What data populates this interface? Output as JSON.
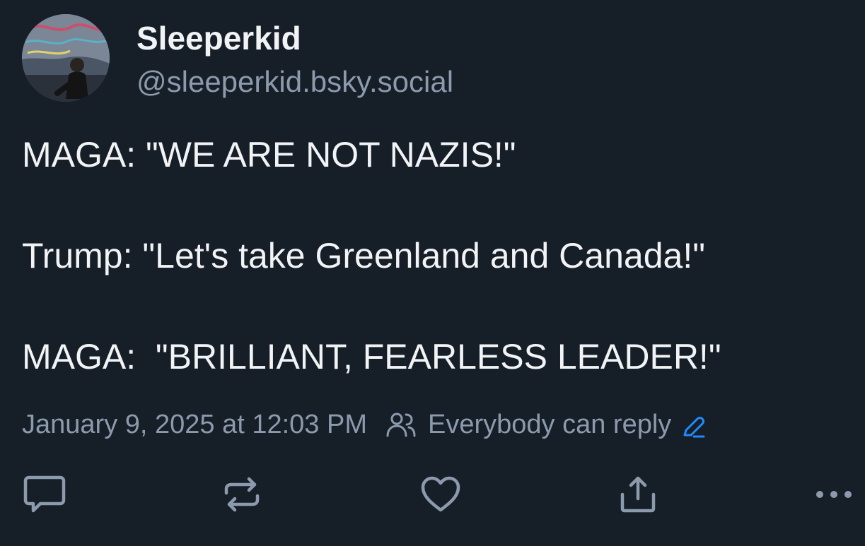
{
  "post": {
    "author": {
      "display_name": "Sleeperkid",
      "handle": "@sleeperkid.bsky.social",
      "avatar_icon": "avatar-photo"
    },
    "lines": [
      "MAGA: \"WE ARE NOT NAZIS!\"",
      "Trump: \"Let's take Greenland and Canada!\"",
      "MAGA:  \"BRILLIANT, FEARLESS LEADER!\""
    ],
    "meta": {
      "timestamp": "January 9, 2025 at 12:03 PM",
      "reply_setting": "Everybody can reply",
      "reply_setting_icon": "people-icon",
      "edit_icon": "pencil-icon"
    },
    "actions": [
      {
        "name": "reply",
        "icon": "comment-icon"
      },
      {
        "name": "repost",
        "icon": "repost-icon"
      },
      {
        "name": "like",
        "icon": "heart-icon"
      },
      {
        "name": "share",
        "icon": "share-icon"
      },
      {
        "name": "more",
        "icon": "ellipsis-icon"
      }
    ]
  },
  "colors": {
    "background": "#161e27",
    "text_primary": "#f1f3f5",
    "text_secondary": "#8c9aad",
    "accent": "#208bfe"
  }
}
